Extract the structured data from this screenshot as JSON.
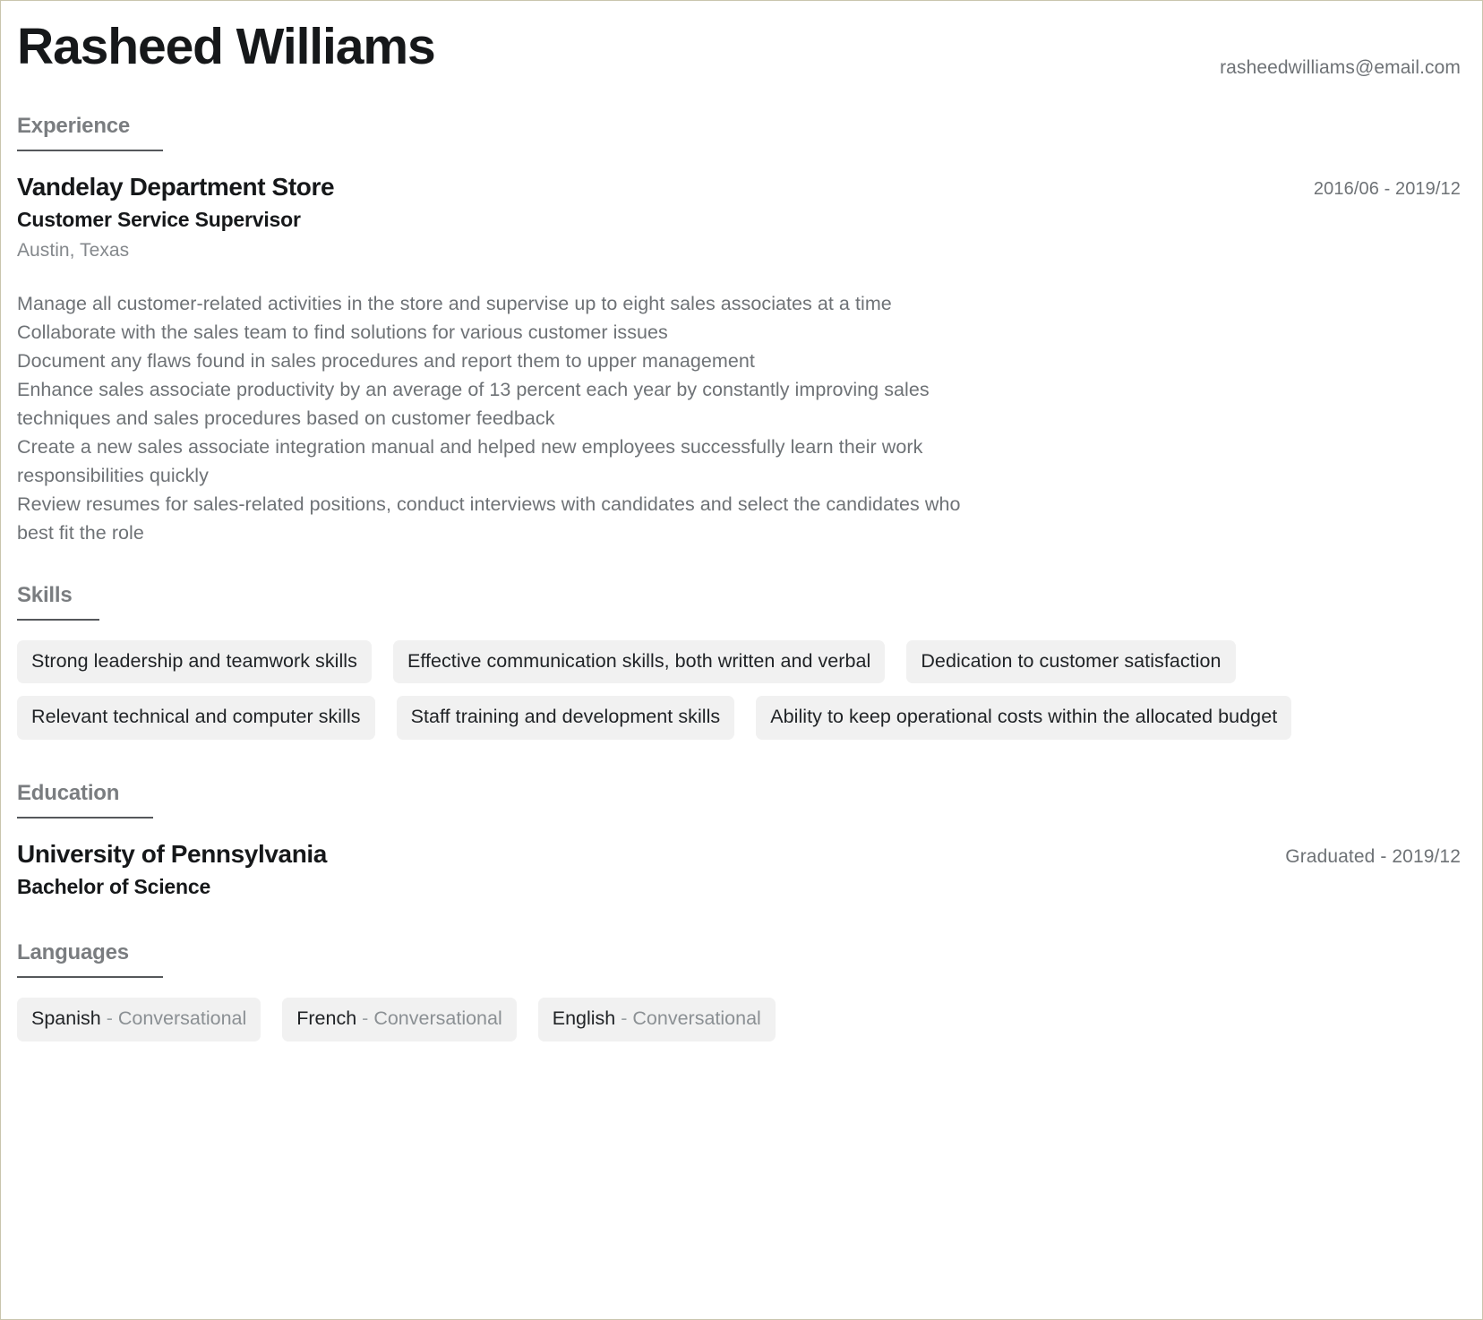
{
  "header": {
    "full_name": "Rasheed Williams",
    "email": "rasheedwilliams@email.com"
  },
  "sections": {
    "experience": {
      "title": "Experience",
      "entries": [
        {
          "organization": "Vandelay Department Store",
          "job_title": "Customer Service Supervisor",
          "location": "Austin, Texas",
          "date_range": "2016/06 - 2019/12",
          "bullets": [
            "Manage all customer-related activities in the store and supervise up to eight sales associates at a time",
            "Collaborate with the sales team to find solutions for various customer issues",
            "Document any flaws found in sales procedures and report them to upper management",
            "Enhance sales associate productivity by an average of 13 percent each year by constantly improving sales techniques and sales procedures based on customer feedback",
            "Create a new sales associate integration manual and helped new employees successfully learn their work responsibilities quickly",
            "Review resumes for sales-related positions, conduct interviews with candidates and select the candidates who best fit the role"
          ]
        }
      ]
    },
    "skills": {
      "title": "Skills",
      "items": [
        "Strong leadership and teamwork skills",
        "Effective communication skills, both written and verbal",
        "Dedication to customer satisfaction",
        "Relevant technical and computer skills",
        "Staff training and development skills",
        "Ability to keep operational costs within the allocated budget"
      ]
    },
    "education": {
      "title": "Education",
      "entries": [
        {
          "school": "University of Pennsylvania",
          "degree": "Bachelor of Science",
          "date_range": "Graduated - 2019/12"
        }
      ]
    },
    "languages": {
      "title": "Languages",
      "separator": "-",
      "items": [
        {
          "name": "Spanish",
          "level": "Conversational"
        },
        {
          "name": "French",
          "level": "Conversational"
        },
        {
          "name": "English",
          "level": "Conversational"
        }
      ]
    }
  }
}
